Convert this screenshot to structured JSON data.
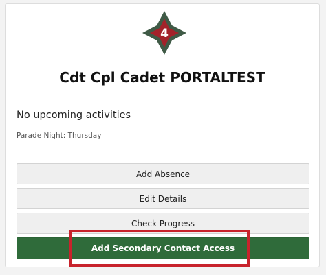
{
  "profile": {
    "rank_badge_number": "4",
    "name": "Cdt Cpl Cadet PORTALTEST",
    "activities_text": "No upcoming activities",
    "parade_night": "Parade Night: Thursday"
  },
  "actions": {
    "add_absence": "Add Absence",
    "edit_details": "Edit Details",
    "check_progress": "Check Progress",
    "add_secondary_contact": "Add Secondary Contact Access"
  },
  "colors": {
    "badge_outer": "#3f5a46",
    "badge_inner": "#a3222a",
    "primary_button": "#2f6b3a",
    "highlight_box": "#c8232c"
  }
}
